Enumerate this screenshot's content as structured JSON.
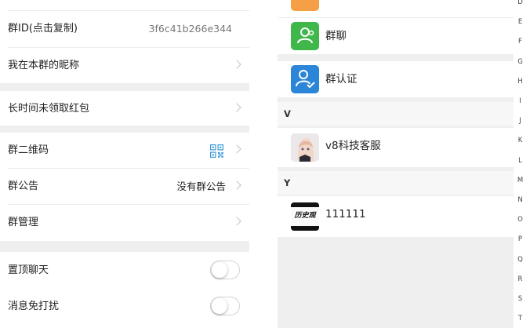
{
  "settings": {
    "group_id": {
      "label": "群ID(点击复制)",
      "value": "3f6c41b266e344"
    },
    "my_nickname": {
      "label": "我在本群的昵称"
    },
    "unclaimed_red_packets": {
      "label": "长时间未领取红包"
    },
    "group_qrcode": {
      "label": "群二维码"
    },
    "announcement": {
      "label": "群公告",
      "value": "没有群公告"
    },
    "management": {
      "label": "群管理"
    },
    "pin_chat": {
      "label": "置顶聊天",
      "on": false
    },
    "mute": {
      "label": "消息免打扰",
      "on": false
    }
  },
  "contacts": {
    "rows": [
      {
        "label": "群聊",
        "icon": "group-chat-icon",
        "color": "#3fb74a"
      },
      {
        "label": "群认证",
        "icon": "group-verify-icon",
        "color": "#2b86d8"
      }
    ],
    "sections": [
      {
        "header": "V",
        "items": [
          {
            "name": "v8科技客服",
            "avatar": "anime-girl-avatar"
          }
        ]
      },
      {
        "header": "Y",
        "items": [
          {
            "name": "111111",
            "avatar": "history-avatar",
            "avatar_text": "历史观"
          }
        ]
      }
    ],
    "top_icon_color": "#f5a046"
  },
  "index_bar": [
    "D",
    "E",
    "F",
    "G",
    "H",
    "I",
    "J",
    "K",
    "L",
    "M",
    "N",
    "O",
    "P",
    "Q",
    "R",
    "S",
    "T"
  ]
}
